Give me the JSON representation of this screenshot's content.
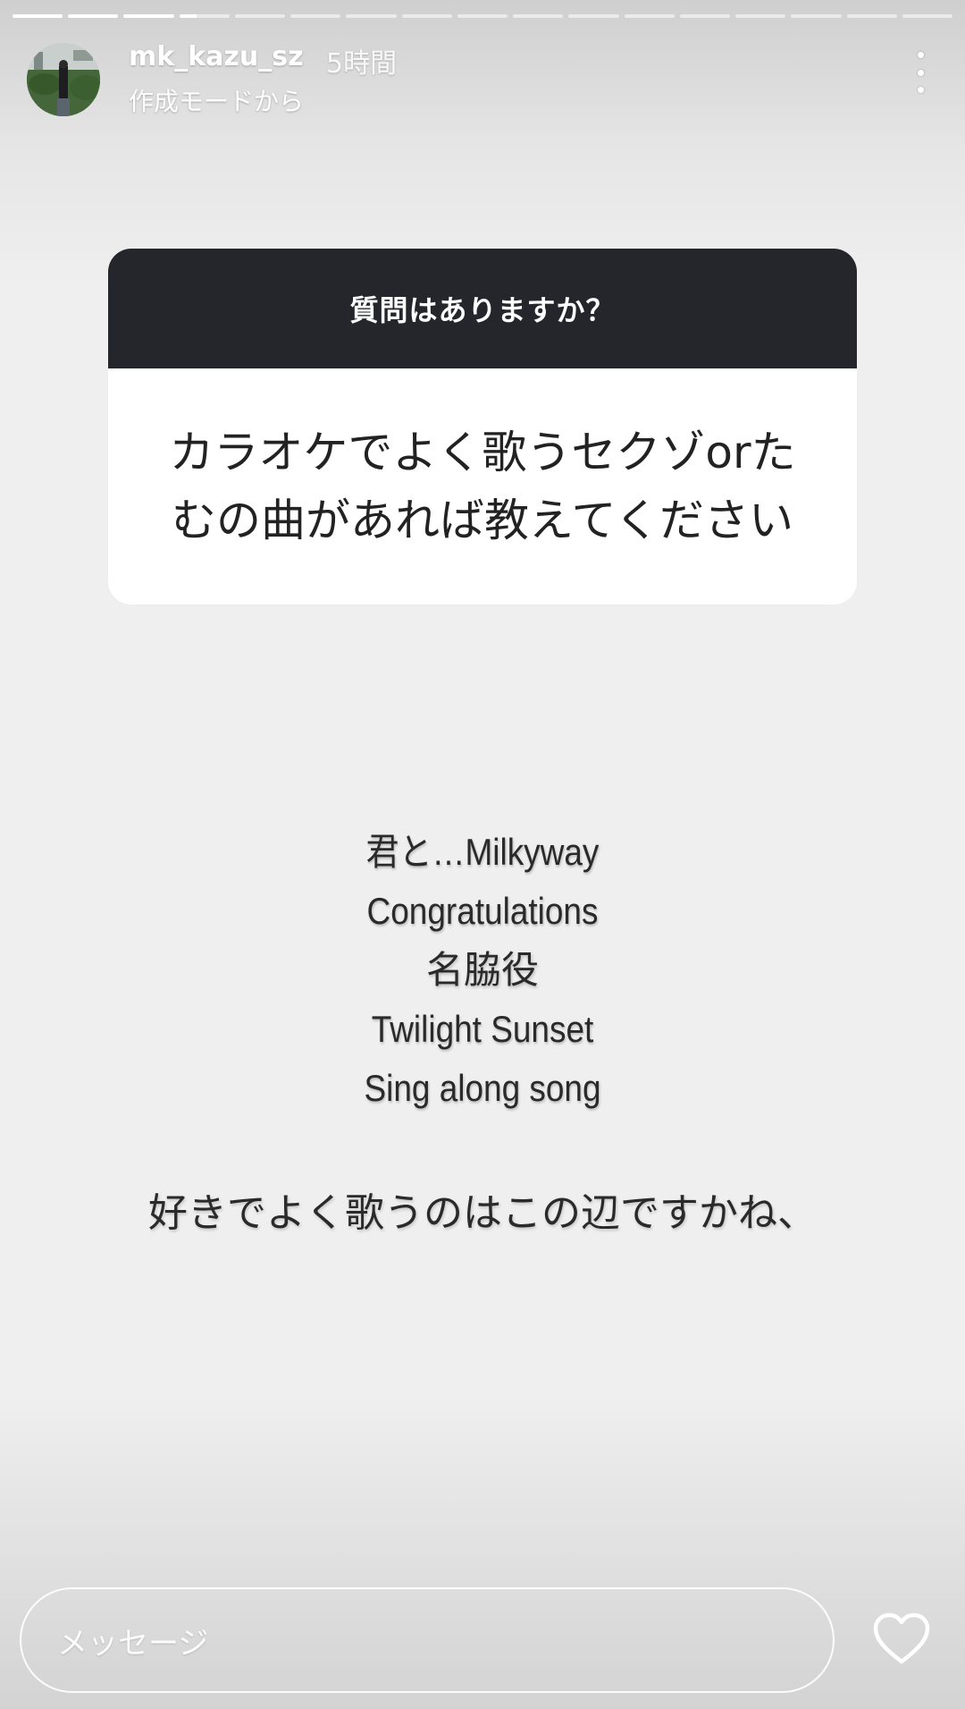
{
  "story": {
    "segments_total": 17,
    "segments_done": 3,
    "current_segment_progress": 0.35
  },
  "header": {
    "username": "mk_kazu_sz",
    "time": "5時間",
    "subtitle": "作成モードから"
  },
  "question_card": {
    "title": "質問はありますか？",
    "question_line1": "カラオケでよく歌うセクゾorた",
    "question_line2": "むの曲があれば教えてください"
  },
  "answer": {
    "songs": [
      "君と…Milkyway",
      "Congratulations",
      "名脇役",
      "Twilight Sunset",
      "Sing along song"
    ],
    "comment": "好きでよく歌うのはこの辺ですかね、"
  },
  "footer": {
    "message_placeholder": "メッセージ"
  },
  "colors": {
    "card_header": "#25262c",
    "card_body": "#ffffff",
    "background": "#efefef"
  },
  "icons": {
    "more": "more-vertical-icon",
    "heart": "heart-outline-icon"
  }
}
